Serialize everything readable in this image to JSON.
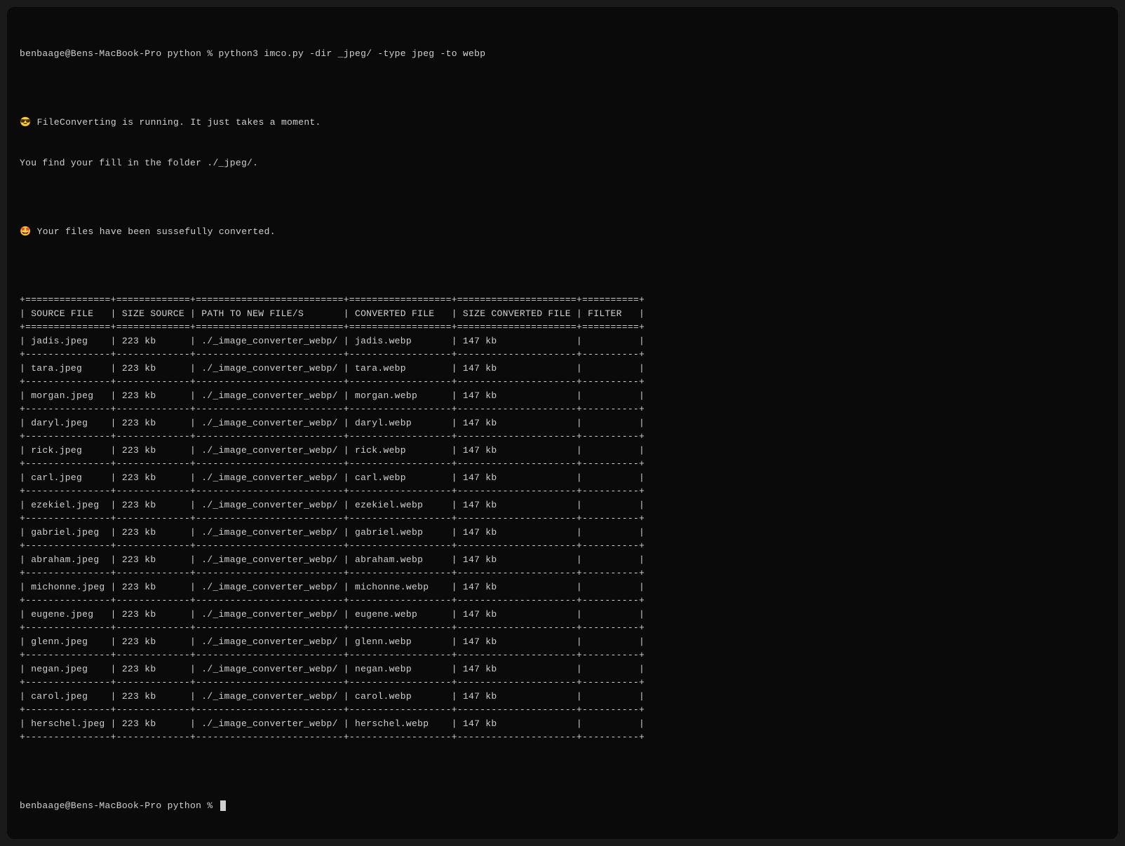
{
  "prompt1": "benbaage@Bens-MacBook-Pro python % python3 imco.py -dir _jpeg/ -type jpeg -to webp",
  "blank1": "",
  "msg_running": "😎 FileConverting is running. It just takes a moment.",
  "msg_folder": "You find your fill in the folder ./_jpeg/.",
  "blank2": "",
  "msg_done": "🤩 Your files have been sussefully converted.",
  "blank3": "",
  "table": {
    "header_sep": "+=============+=============+==========================+================+=====================+========+",
    "header_row": "| SOURCE FILE   | SIZE SOURCE   | PATH TO NEW FILE/S       | CONVERTED FILE   | SIZE CONVERTED FILE   | FILTER   |",
    "header_sep2": "+===============+===============+==========================+==================+=======================+==========+",
    "row_sep": "+---------------+---------------+--------------------------+------------------+-----------------------+----------+",
    "columns": [
      "SOURCE FILE",
      "SIZE SOURCE",
      "PATH TO NEW FILE/S",
      "CONVERTED FILE",
      "SIZE CONVERTED FILE",
      "FILTER"
    ],
    "rows": [
      {
        "source_file": "jadis.jpeg",
        "size_source": "223 kb",
        "path": "./_image_converter_webp/",
        "converted_file": "jadis.webp",
        "size_converted": "147 kb",
        "filter": ""
      },
      {
        "source_file": "tara.jpeg",
        "size_source": "223 kb",
        "path": "./_image_converter_webp/",
        "converted_file": "tara.webp",
        "size_converted": "147 kb",
        "filter": ""
      },
      {
        "source_file": "morgan.jpeg",
        "size_source": "223 kb",
        "path": "./_image_converter_webp/",
        "converted_file": "morgan.webp",
        "size_converted": "147 kb",
        "filter": ""
      },
      {
        "source_file": "daryl.jpeg",
        "size_source": "223 kb",
        "path": "./_image_converter_webp/",
        "converted_file": "daryl.webp",
        "size_converted": "147 kb",
        "filter": ""
      },
      {
        "source_file": "rick.jpeg",
        "size_source": "223 kb",
        "path": "./_image_converter_webp/",
        "converted_file": "rick.webp",
        "size_converted": "147 kb",
        "filter": ""
      },
      {
        "source_file": "carl.jpeg",
        "size_source": "223 kb",
        "path": "./_image_converter_webp/",
        "converted_file": "carl.webp",
        "size_converted": "147 kb",
        "filter": ""
      },
      {
        "source_file": "ezekiel.jpeg",
        "size_source": "223 kb",
        "path": "./_image_converter_webp/",
        "converted_file": "ezekiel.webp",
        "size_converted": "147 kb",
        "filter": ""
      },
      {
        "source_file": "gabriel.jpeg",
        "size_source": "223 kb",
        "path": "./_image_converter_webp/",
        "converted_file": "gabriel.webp",
        "size_converted": "147 kb",
        "filter": ""
      },
      {
        "source_file": "abraham.jpeg",
        "size_source": "223 kb",
        "path": "./_image_converter_webp/",
        "converted_file": "abraham.webp",
        "size_converted": "147 kb",
        "filter": ""
      },
      {
        "source_file": "michonne.jpeg",
        "size_source": "223 kb",
        "path": "./_image_converter_webp/",
        "converted_file": "michonne.webp",
        "size_converted": "147 kb",
        "filter": ""
      },
      {
        "source_file": "eugene.jpeg",
        "size_source": "223 kb",
        "path": "./_image_converter_webp/",
        "converted_file": "eugene.webp",
        "size_converted": "147 kb",
        "filter": ""
      },
      {
        "source_file": "glenn.jpeg",
        "size_source": "223 kb",
        "path": "./_image_converter_webp/",
        "converted_file": "glenn.webp",
        "size_converted": "147 kb",
        "filter": ""
      },
      {
        "source_file": "negan.jpeg",
        "size_source": "223 kb",
        "path": "./_image_converter_webp/",
        "converted_file": "negan.webp",
        "size_converted": "147 kb",
        "filter": ""
      },
      {
        "source_file": "carol.jpeg",
        "size_source": "223 kb",
        "path": "./_image_converter_webp/",
        "converted_file": "carol.webp",
        "size_converted": "147 kb",
        "filter": ""
      },
      {
        "source_file": "herschel.jpeg",
        "size_source": "223 kb",
        "path": "./_image_converter_webp/",
        "converted_file": "herschel.webp",
        "size_converted": "147 kb",
        "filter": ""
      }
    ]
  },
  "blank4": "",
  "prompt2": "benbaage@Bens-MacBook-Pro python % "
}
